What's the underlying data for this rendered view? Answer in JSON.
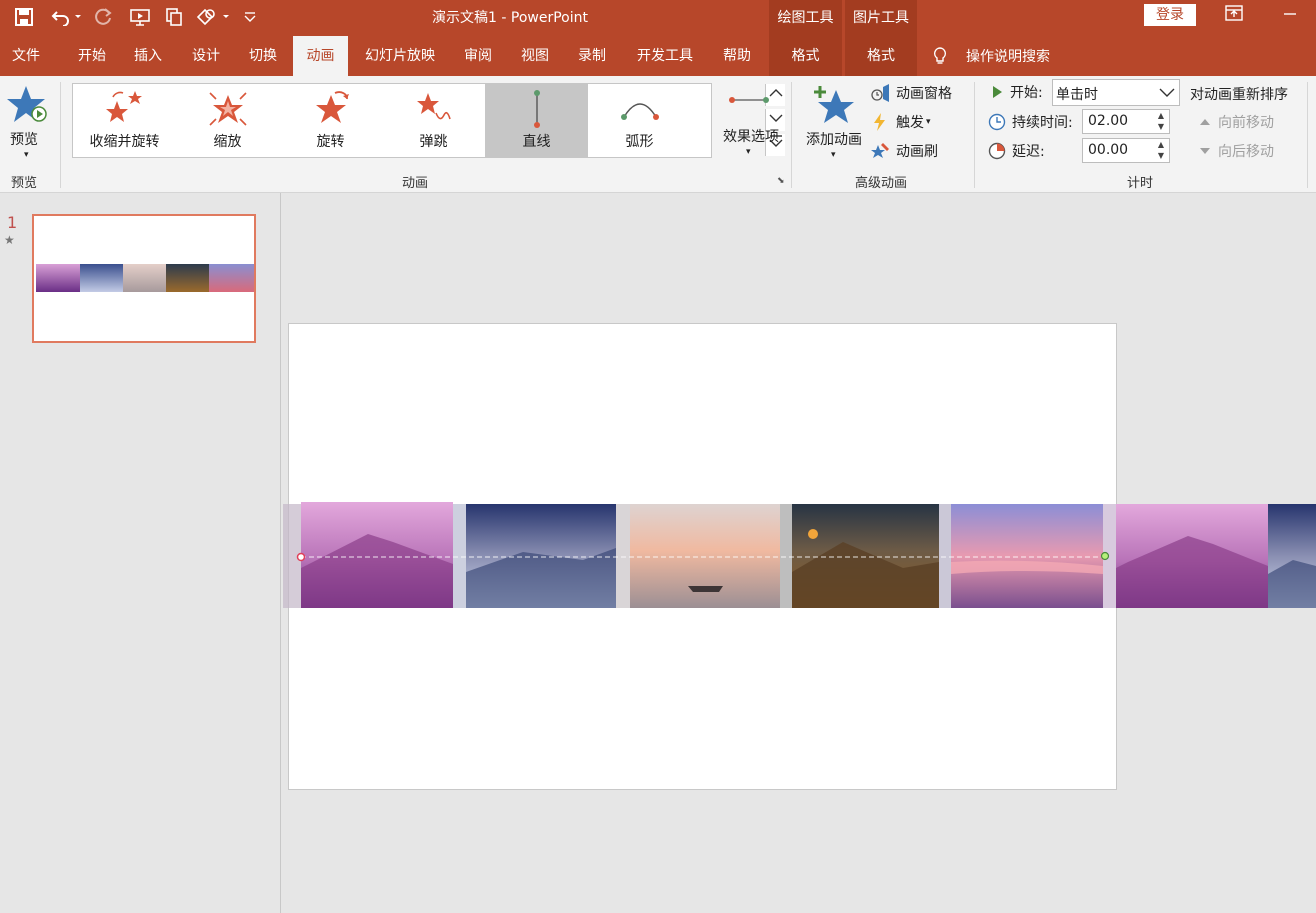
{
  "app": {
    "doc_title": "演示文稿1  -  PowerPoint",
    "login": "登录",
    "accent": "#b7472a"
  },
  "context_groups": {
    "drawing_tools": "绘图工具",
    "picture_tools": "图片工具"
  },
  "tabs": {
    "file": "文件",
    "home": "开始",
    "insert": "插入",
    "design": "设计",
    "transitions": "切换",
    "animations": "动画",
    "slideshow": "幻灯片放映",
    "review": "审阅",
    "view": "视图",
    "record": "录制",
    "developer": "开发工具",
    "help": "帮助",
    "format1": "格式",
    "format2": "格式",
    "tell_me": "操作说明搜索"
  },
  "ribbon": {
    "preview": {
      "button": "预览",
      "group": "预览"
    },
    "animation": {
      "group": "动画",
      "gallery": [
        "收缩并旋转",
        "缩放",
        "旋转",
        "弹跳",
        "直线",
        "弧形"
      ],
      "selected": "直线",
      "effect_options": "效果选项"
    },
    "advanced": {
      "group": "高级动画",
      "add_animation": "添加动画",
      "animation_pane": "动画窗格",
      "trigger": "触发",
      "painter": "动画刷"
    },
    "timing": {
      "group": "计时",
      "start_label": "开始:",
      "start_value": "单击时",
      "duration_label": "持续时间:",
      "duration_value": "02.00",
      "delay_label": "延迟:",
      "delay_value": "00.00",
      "reorder": "对动画重新排序",
      "move_earlier": "向前移动",
      "move_later": "向后移动"
    }
  },
  "thumbnails": {
    "slide_number": "1"
  }
}
